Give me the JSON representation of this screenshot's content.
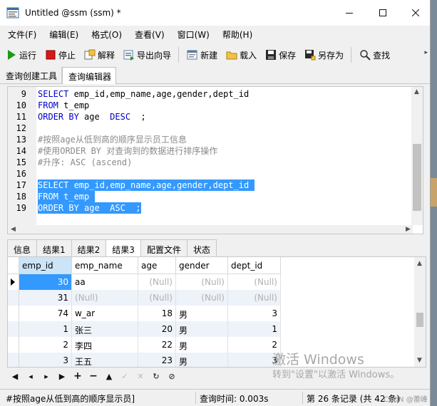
{
  "window": {
    "title": "Untitled @ssm (ssm) *"
  },
  "menu": [
    "文件(F)",
    "编辑(E)",
    "格式(O)",
    "查看(V)",
    "窗口(W)",
    "帮助(H)"
  ],
  "toolbar": {
    "run": "运行",
    "stop": "停止",
    "explain": "解释",
    "export": "导出向导",
    "new": "新建",
    "load": "载入",
    "save": "保存",
    "saveas": "另存为",
    "find": "查找"
  },
  "tabs": [
    "查询创建工具",
    "查询编辑器"
  ],
  "editor": {
    "lines": [
      {
        "n": "9",
        "parts": [
          [
            "kw",
            "SELECT"
          ],
          [
            "",
            "emp_id,emp_name,age,gender,dept_id"
          ]
        ]
      },
      {
        "n": "10",
        "parts": [
          [
            "kw",
            "FROM"
          ],
          [
            "",
            "t_emp"
          ]
        ]
      },
      {
        "n": "11",
        "parts": [
          [
            "kw",
            "ORDER BY"
          ],
          [
            "",
            "age  "
          ],
          [
            "kw",
            "DESC"
          ],
          [
            "",
            " ;"
          ]
        ]
      },
      {
        "n": "12",
        "parts": []
      },
      {
        "n": "13",
        "parts": [
          [
            "cm",
            "#按照age从低到高的顺序显示员工信息"
          ]
        ]
      },
      {
        "n": "14",
        "parts": [
          [
            "cm",
            "#使用ORDER BY 对查询到的数据进行排序操作"
          ]
        ]
      },
      {
        "n": "15",
        "parts": [
          [
            "cm",
            "#升序: ASC (ascend)"
          ]
        ]
      },
      {
        "n": "16",
        "parts": []
      },
      {
        "n": "17",
        "selected": true,
        "parts": [
          [
            "",
            "SELECT emp_id,emp_name,age,gender,dept_id "
          ]
        ]
      },
      {
        "n": "18",
        "selected": true,
        "parts": [
          [
            "",
            "FROM t_emp "
          ]
        ]
      },
      {
        "n": "19",
        "selected": true,
        "parts": [
          [
            "",
            "ORDER BY age  ASC  ;"
          ]
        ]
      }
    ]
  },
  "result_tabs": [
    "信息",
    "结果1",
    "结果2",
    "结果3",
    "配置文件",
    "状态"
  ],
  "grid": {
    "columns": [
      "emp_id",
      "emp_name",
      "age",
      "gender",
      "dept_id"
    ],
    "rows": [
      [
        "30",
        "aa",
        "(Null)",
        "(Null)",
        "(Null)"
      ],
      [
        "31",
        "(Null)",
        "(Null)",
        "(Null)",
        "(Null)"
      ],
      [
        "74",
        "w_ar",
        "18",
        "男",
        "3"
      ],
      [
        "1",
        "张三",
        "20",
        "男",
        "1"
      ],
      [
        "2",
        "李四",
        "22",
        "男",
        "2"
      ],
      [
        "3",
        "王五",
        "23",
        "男",
        "3"
      ]
    ]
  },
  "watermark": {
    "line1": "激活 Windows",
    "line2": "转到\"设置\"以激活 Windows。"
  },
  "status": {
    "sql": "#按照age从低到高的顺序显示员]",
    "time": "查询时间: 0.003s",
    "records": "第 26 条记录 (共 42 条)",
    "signature": "CSDN @蕾峰"
  },
  "colors": {
    "selection": "#3399ff",
    "keyword": "#0000c8",
    "comment": "#8a8a8a"
  }
}
